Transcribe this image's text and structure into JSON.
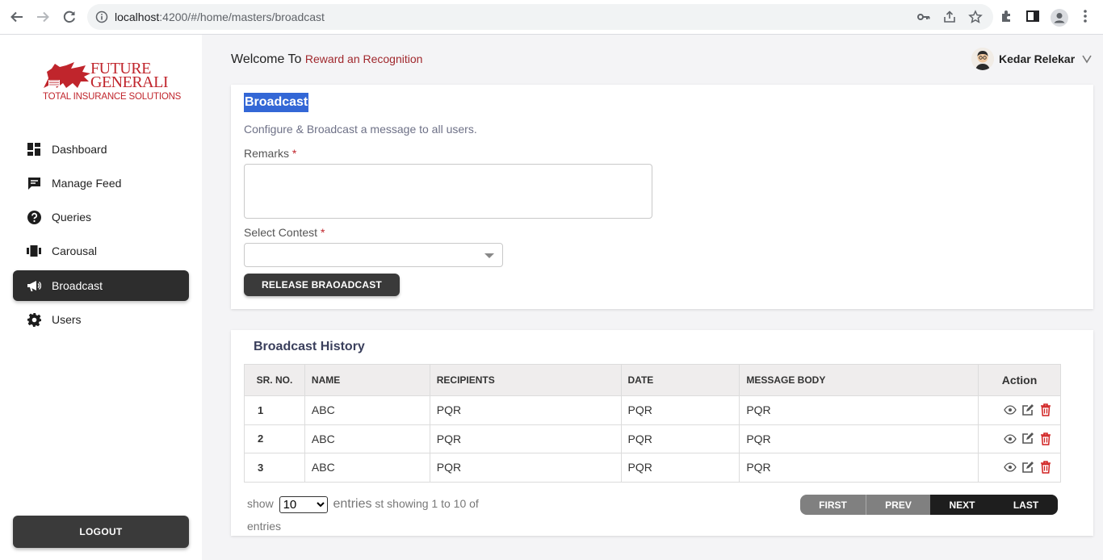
{
  "browser": {
    "url_host": "localhost",
    "url_path": ":4200/#/home/masters/broadcast"
  },
  "brand": {
    "name_line1": "FUTURE",
    "name_line2": "GENERALI",
    "tagline": "TOTAL INSURANCE SOLUTIONS",
    "color": "#c0252c"
  },
  "sidebar": {
    "items": [
      {
        "label": "Dashboard",
        "icon": "dashboard-icon"
      },
      {
        "label": "Manage Feed",
        "icon": "chat-icon"
      },
      {
        "label": "Queries",
        "icon": "help-circle-icon"
      },
      {
        "label": "Carousal",
        "icon": "carousel-icon"
      },
      {
        "label": "Broadcast",
        "icon": "megaphone-icon",
        "active": true
      },
      {
        "label": "Users",
        "icon": "gear-icon"
      }
    ],
    "logout_label": "LOGOUT"
  },
  "header": {
    "welcome_prefix": "Welcome To",
    "app_name": "Reward an Recognition",
    "user_name": "Kedar Relekar"
  },
  "broadcast_form": {
    "title": "Broadcast",
    "subtitle": "Configure & Broadcast a message to all users.",
    "remarks_label": "Remarks",
    "remarks_value": "",
    "contest_label": "Select Contest",
    "contest_value": "",
    "required_mark": "*",
    "release_button": "RELEASE BRAOADCAST"
  },
  "history": {
    "title": "Broadcast History",
    "columns": [
      "SR. NO.",
      "NAME",
      "RECIPIENTS",
      "DATE",
      "MESSAGE BODY",
      "Action"
    ],
    "rows": [
      {
        "sr": "1",
        "name": "ABC",
        "recipients": "PQR",
        "date": "PQR",
        "message": "PQR"
      },
      {
        "sr": "2",
        "name": "ABC",
        "recipients": "PQR",
        "date": "PQR",
        "message": "PQR"
      },
      {
        "sr": "3",
        "name": "ABC",
        "recipients": "PQR",
        "date": "PQR",
        "message": "PQR"
      }
    ],
    "show_label": "show",
    "page_size": "10",
    "entries_word": "entries",
    "showing_text": "st showing 1 to 10 of",
    "entries_line2": "entries",
    "pager": {
      "first": "FIRST",
      "prev": "PREV",
      "next": "NEXT",
      "last": "LAST"
    }
  },
  "colors": {
    "accent_red": "#c0252c",
    "dark_button": "#3a3a3a",
    "selection_blue": "#3367d6"
  }
}
